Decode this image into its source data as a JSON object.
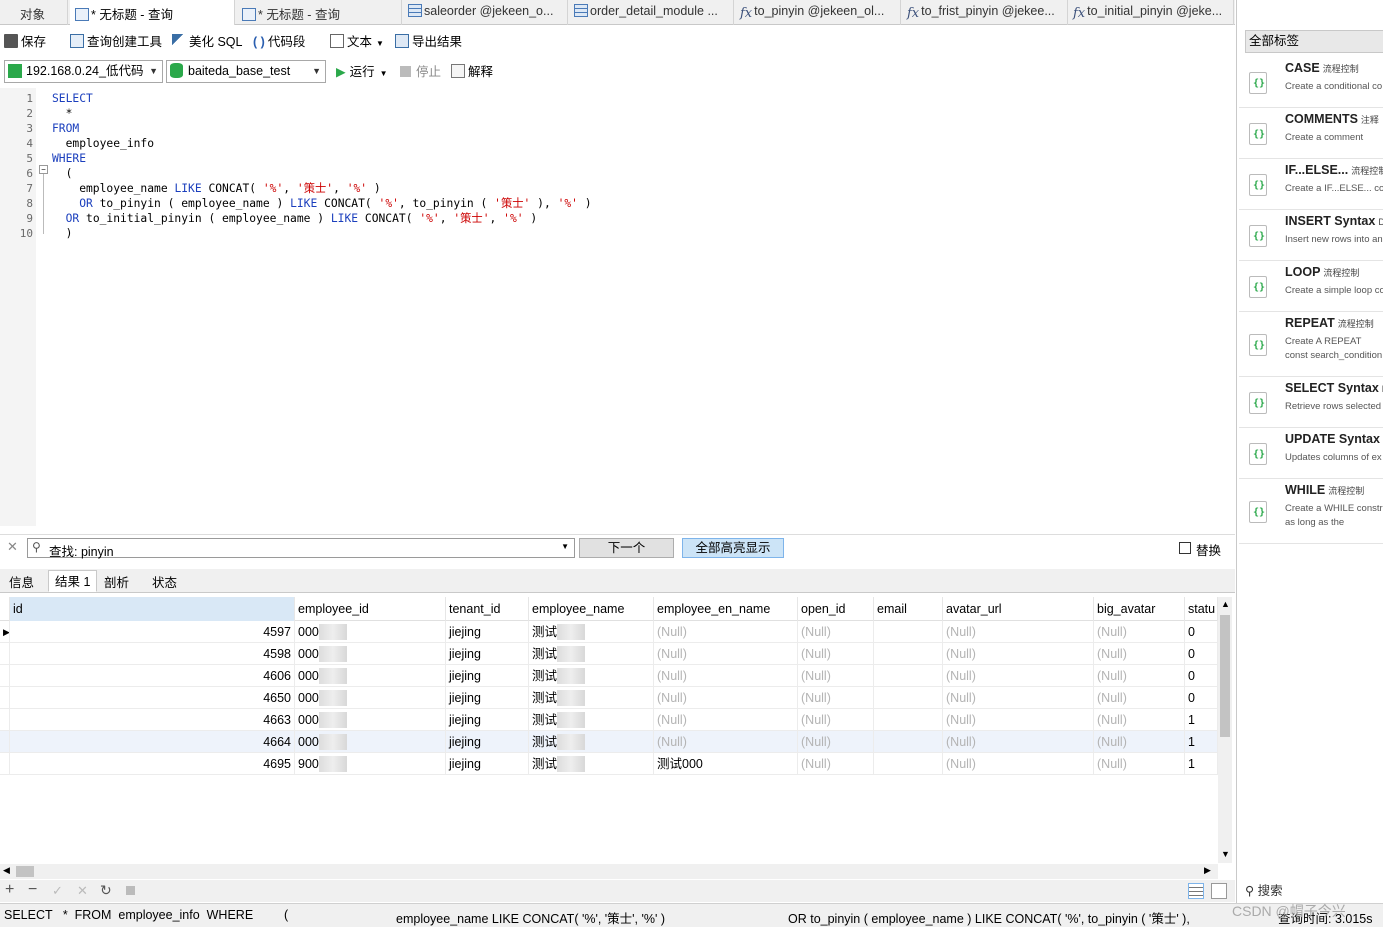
{
  "tabs": [
    {
      "label": "对象",
      "icon": "none"
    },
    {
      "label": "* 无标题 - 查询",
      "icon": "query-icon"
    },
    {
      "label": "* 无标题 - 查询",
      "icon": "query-icon"
    },
    {
      "label": "saleorder @jekeen_o...",
      "icon": "table-icon"
    },
    {
      "label": "order_detail_module ...",
      "icon": "table-icon"
    },
    {
      "label": "to_pinyin @jekeen_ol...",
      "icon": "function-icon"
    },
    {
      "label": "to_frist_pinyin @jekee...",
      "icon": "function-icon"
    },
    {
      "label": "to_initial_pinyin @jeke...",
      "icon": "function-icon"
    }
  ],
  "toolbar": {
    "save": "保存",
    "query_builder": "查询创建工具",
    "beautify": "美化 SQL",
    "snippet": "代码段",
    "text": "文本",
    "export": "导出结果"
  },
  "toolbar2": {
    "connection": "192.168.0.24_低代码",
    "database": "baiteda_base_test",
    "run": "运行",
    "stop": "停止",
    "explain": "解释"
  },
  "editor": {
    "lines": [
      {
        "n": "1",
        "parts": [
          {
            "t": "SELECT",
            "k": "kw"
          }
        ]
      },
      {
        "n": "2",
        "parts": [
          {
            "t": "  *",
            "k": ""
          }
        ]
      },
      {
        "n": "3",
        "parts": [
          {
            "t": "FROM",
            "k": "kw"
          }
        ]
      },
      {
        "n": "4",
        "parts": [
          {
            "t": "  employee_info",
            "k": ""
          }
        ]
      },
      {
        "n": "5",
        "parts": [
          {
            "t": "WHERE",
            "k": "kw"
          }
        ]
      },
      {
        "n": "6",
        "parts": [
          {
            "t": "  (",
            "k": ""
          }
        ]
      },
      {
        "n": "7",
        "parts": [
          {
            "t": "    employee_name ",
            "k": ""
          },
          {
            "t": "LIKE",
            "k": "kw"
          },
          {
            "t": " CONCAT( ",
            "k": ""
          },
          {
            "t": "'%'",
            "k": "st"
          },
          {
            "t": ", ",
            "k": ""
          },
          {
            "t": "'策士'",
            "k": "st"
          },
          {
            "t": ", ",
            "k": ""
          },
          {
            "t": "'%'",
            "k": "st"
          },
          {
            "t": " )",
            "k": ""
          }
        ]
      },
      {
        "n": "8",
        "parts": [
          {
            "t": "    ",
            "k": ""
          },
          {
            "t": "OR",
            "k": "kw"
          },
          {
            "t": " to_pinyin ( employee_name ) ",
            "k": ""
          },
          {
            "t": "LIKE",
            "k": "kw"
          },
          {
            "t": " CONCAT( ",
            "k": ""
          },
          {
            "t": "'%'",
            "k": "st"
          },
          {
            "t": ", to_pinyin ( ",
            "k": ""
          },
          {
            "t": "'策士'",
            "k": "st"
          },
          {
            "t": " ), ",
            "k": ""
          },
          {
            "t": "'%'",
            "k": "st"
          },
          {
            "t": " )",
            "k": ""
          }
        ]
      },
      {
        "n": "9",
        "parts": [
          {
            "t": "  ",
            "k": ""
          },
          {
            "t": "OR",
            "k": "kw"
          },
          {
            "t": " to_initial_pinyin ( employee_name ) ",
            "k": ""
          },
          {
            "t": "LIKE",
            "k": "kw"
          },
          {
            "t": " CONCAT( ",
            "k": ""
          },
          {
            "t": "'%'",
            "k": "st"
          },
          {
            "t": ", ",
            "k": ""
          },
          {
            "t": "'策士'",
            "k": "st"
          },
          {
            "t": ", ",
            "k": ""
          },
          {
            "t": "'%'",
            "k": "st"
          },
          {
            "t": " )",
            "k": ""
          }
        ]
      },
      {
        "n": "10",
        "parts": [
          {
            "t": "  )",
            "k": ""
          }
        ]
      }
    ]
  },
  "find": {
    "value": "查找: pinyin",
    "next": "下一个",
    "highlight_all": "全部高亮显示",
    "replace": "替换"
  },
  "result_tabs": [
    "信息",
    "结果 1",
    "剖析",
    "状态"
  ],
  "grid": {
    "columns": [
      "id",
      "employee_id",
      "tenant_id",
      "employee_name",
      "employee_en_name",
      "open_id",
      "email",
      "avatar_url",
      "big_avatar",
      "statu"
    ],
    "rows": [
      {
        "id": "4597",
        "employee_id": "000",
        "tenant_id": "jiejing",
        "employee_name": "测试",
        "employee_en_name": "(Null)",
        "open_id": "(Null)",
        "email": "",
        "avatar_url": "(Null)",
        "big_avatar": "(Null)",
        "status": "0"
      },
      {
        "id": "4598",
        "employee_id": "000",
        "tenant_id": "jiejing",
        "employee_name": "测试",
        "employee_en_name": "(Null)",
        "open_id": "(Null)",
        "email": "",
        "avatar_url": "(Null)",
        "big_avatar": "(Null)",
        "status": "0"
      },
      {
        "id": "4606",
        "employee_id": "000",
        "tenant_id": "jiejing",
        "employee_name": "测试",
        "employee_en_name": "(Null)",
        "open_id": "(Null)",
        "email": "",
        "avatar_url": "(Null)",
        "big_avatar": "(Null)",
        "status": "0"
      },
      {
        "id": "4650",
        "employee_id": "000",
        "tenant_id": "jiejing",
        "employee_name": "测试",
        "employee_en_name": "(Null)",
        "open_id": "(Null)",
        "email": "",
        "avatar_url": "(Null)",
        "big_avatar": "(Null)",
        "status": "0"
      },
      {
        "id": "4663",
        "employee_id": "000",
        "tenant_id": "jiejing",
        "employee_name": "测试",
        "employee_en_name": "(Null)",
        "open_id": "(Null)",
        "email": "",
        "avatar_url": "(Null)",
        "big_avatar": "(Null)",
        "status": "1"
      },
      {
        "id": "4664",
        "employee_id": "000",
        "tenant_id": "jiejing",
        "employee_name": "测试",
        "employee_en_name": "(Null)",
        "open_id": "(Null)",
        "email": "",
        "avatar_url": "(Null)",
        "big_avatar": "(Null)",
        "status": "1"
      },
      {
        "id": "4695",
        "employee_id": "900",
        "tenant_id": "jiejing",
        "employee_name": "测试",
        "employee_en_name": "测试000",
        "open_id": "(Null)",
        "email": "",
        "avatar_url": "(Null)",
        "big_avatar": "(Null)",
        "status": "1"
      }
    ]
  },
  "statusbar": {
    "sql1": "SELECT   *  FROM  employee_info  WHERE",
    "sql2": "(",
    "sql3": "employee_name LIKE CONCAT( '%', '策士', '%' )",
    "sql4": "OR to_pinyin ( employee_name ) LIKE CONCAT( '%', to_pinyin ( '策士' ),",
    "time": "查询时间: 3.015s",
    "watermark": "CSDN @帽子今兴"
  },
  "right_panel": {
    "header": "全部标签",
    "search": "搜索",
    "snippets": [
      {
        "title": "CASE",
        "tag": "流程控制",
        "desc": "Create a conditional co"
      },
      {
        "title": "COMMENTS",
        "tag": "注释",
        "desc": "Create a comment"
      },
      {
        "title": "IF...ELSE...",
        "tag": "流程控制",
        "desc": "Create a IF...ELSE... con"
      },
      {
        "title": "INSERT Syntax",
        "tag": "D",
        "desc": "Insert new rows into an"
      },
      {
        "title": "LOOP",
        "tag": "流程控制",
        "desc": "Create a simple loop co"
      },
      {
        "title": "REPEAT",
        "tag": "流程控制",
        "desc": "Create A REPEAT const search_condition expre"
      },
      {
        "title": "SELECT Syntax",
        "tag": "D",
        "desc": "Retrieve rows selected"
      },
      {
        "title": "UPDATE Syntax",
        "tag": "",
        "desc": "Updates columns of ex"
      },
      {
        "title": "WHILE",
        "tag": "流程控制",
        "desc": "Create a WHILE constr as long as the search_c"
      }
    ]
  },
  "colors": {
    "keyword": "#1b3fbd",
    "string": "#cc0000",
    "null_text": "#b4b4b4",
    "run_green": "#2aa84a"
  }
}
